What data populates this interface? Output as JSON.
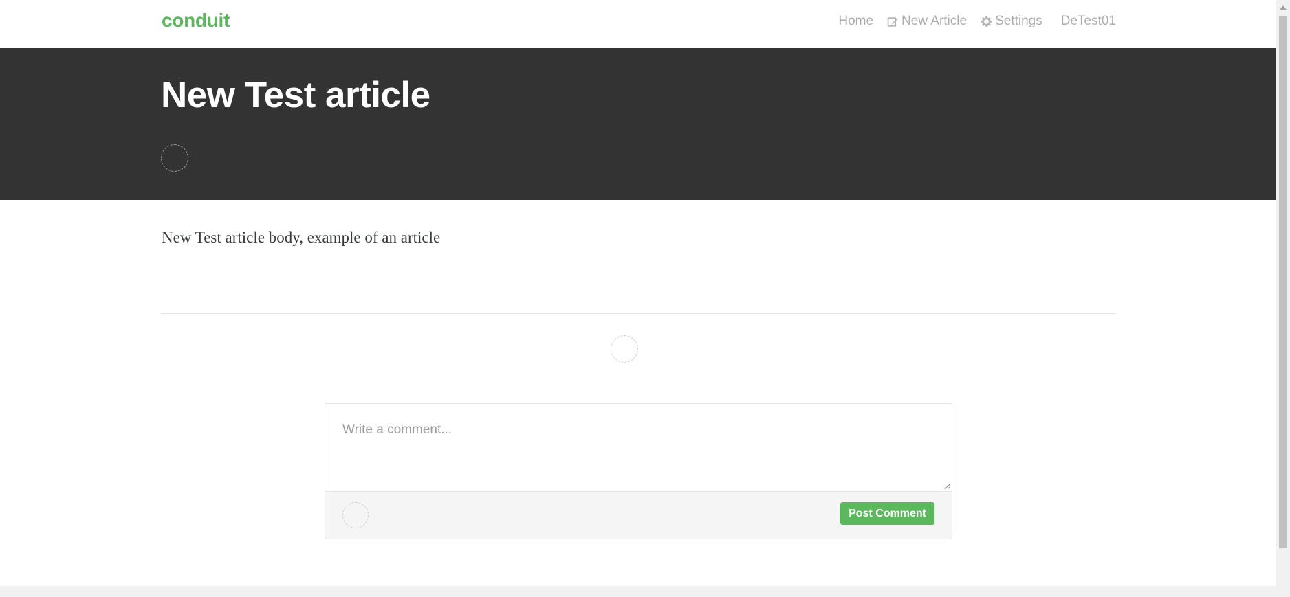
{
  "nav": {
    "brand": "conduit",
    "links": [
      {
        "label": "Home",
        "icon": ""
      },
      {
        "label": "New Article",
        "icon": "edit-icon"
      },
      {
        "label": "Settings",
        "icon": "gear-icon"
      },
      {
        "label": "DeTest01",
        "icon": ""
      }
    ]
  },
  "article": {
    "title": "New Test article",
    "body": "New Test article body, example of an article"
  },
  "comment_form": {
    "placeholder": "Write a comment...",
    "value": "",
    "submit_label": "Post Comment"
  },
  "colors": {
    "brand": "#5cb85c",
    "banner": "#333333",
    "footer": "#f5f5f5"
  }
}
